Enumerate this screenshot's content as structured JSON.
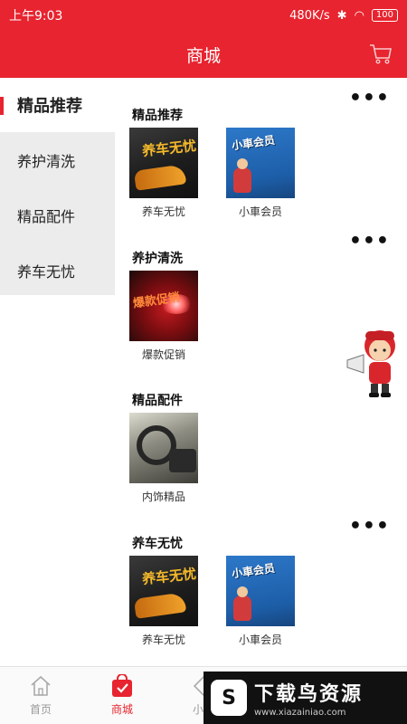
{
  "status": {
    "time": "上午9:03",
    "speed": "480K/s",
    "battery": "100"
  },
  "header": {
    "title": "商城",
    "cart_icon": "shopping-cart-icon"
  },
  "sidebar": {
    "items": [
      {
        "label": "精品推荐",
        "active": true
      },
      {
        "label": "养护清洗",
        "active": false
      },
      {
        "label": "精品配件",
        "active": false
      },
      {
        "label": "养车无忧",
        "active": false
      }
    ]
  },
  "sections": [
    {
      "title": "精品推荐",
      "more": "•••",
      "items": [
        {
          "caption": "养车无忧",
          "image_text": "养车无忧"
        },
        {
          "caption": "小車会员",
          "image_text": "小車会员"
        }
      ]
    },
    {
      "title": "养护清洗",
      "more": "•••",
      "items": [
        {
          "caption": "爆款促销",
          "image_text": "爆款促销"
        }
      ]
    },
    {
      "title": "精品配件",
      "items": [
        {
          "caption": "内饰精品"
        }
      ]
    },
    {
      "title": "养车无忧",
      "more": "•••",
      "items": [
        {
          "caption": "养车无忧",
          "image_text": "养车无忧"
        },
        {
          "caption": "小車会员",
          "image_text": "小車会员"
        }
      ]
    }
  ],
  "tabbar": {
    "items": [
      {
        "label": "首页",
        "icon": "home-icon",
        "active": false
      },
      {
        "label": "商城",
        "icon": "shopping-bag-icon",
        "active": true
      },
      {
        "label": "小車",
        "icon": "tag-icon",
        "active": false
      }
    ]
  },
  "watermark": {
    "title": "下载鸟资源",
    "url": "www.xiazainiao.com"
  },
  "colors": {
    "accent": "#e7242f",
    "sidebar_bg": "#ececec"
  }
}
